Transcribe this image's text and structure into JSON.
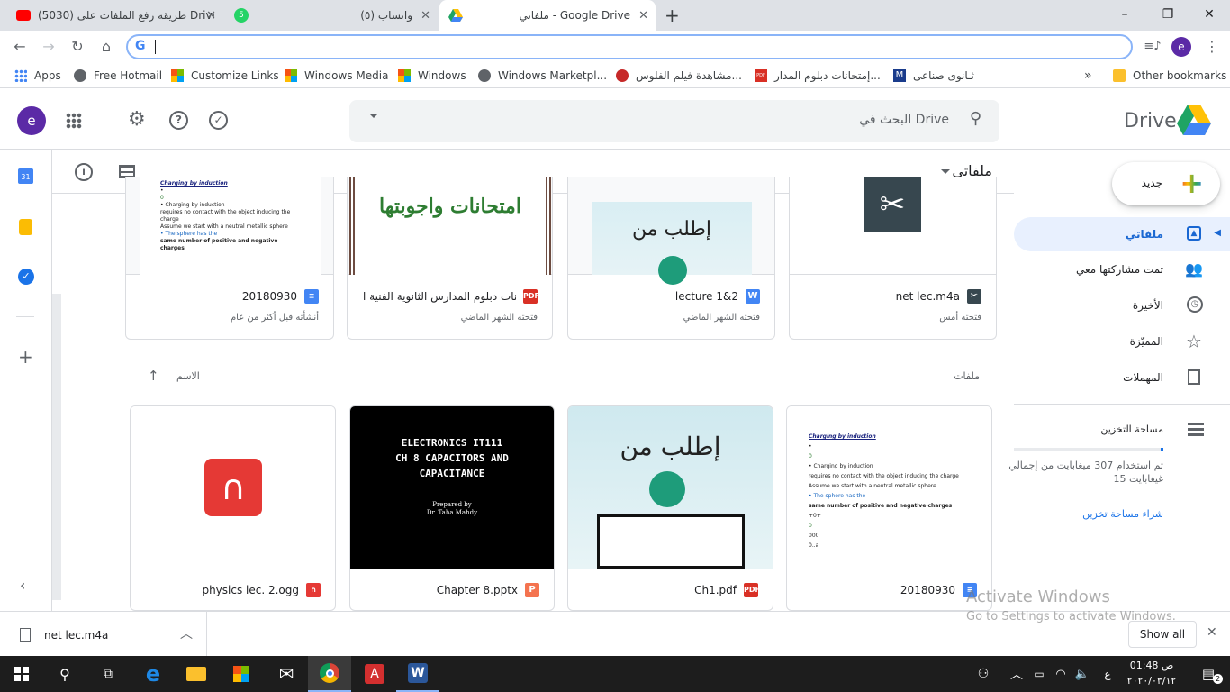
{
  "browser": {
    "tabs": [
      {
        "title": "(5030) طريقة رفع الملفات على Drive",
        "favicon_color": "#ff0000"
      },
      {
        "title": "(٥) واتساب",
        "favicon_color": "#25d366",
        "badge": "5"
      },
      {
        "title": "ملفاتي - Google Drive",
        "favicon_color": "#1fa463",
        "active": true
      }
    ],
    "new_tab": "+",
    "omnibox_value": "",
    "profile_initial": "e",
    "bookmarks": [
      {
        "label": "Apps"
      },
      {
        "label": "Free Hotmail"
      },
      {
        "label": "Customize Links"
      },
      {
        "label": "Windows Media"
      },
      {
        "label": "Windows"
      },
      {
        "label": "Windows Marketpl..."
      },
      {
        "label": "مشاهدة فيلم الفلوس..."
      },
      {
        "label": "إمتحانات دبلوم المدار..."
      },
      {
        "label": "ثـانوى صناعى"
      }
    ],
    "overflow": "»",
    "other_bookmarks": "Other bookmarks"
  },
  "drive": {
    "brand": "Drive",
    "search_placeholder": "البحث في Drive",
    "avatar_initial": "e",
    "breadcrumb": "ملفاتي",
    "new_button": "جديد",
    "nav": [
      {
        "label": "ملفاتي",
        "active": true
      },
      {
        "label": "تمت مشاركتها معي"
      },
      {
        "label": "الأخيرة"
      },
      {
        "label": "المميّزة"
      },
      {
        "label": "المهملات"
      }
    ],
    "storage": {
      "label": "مساحة التخزين",
      "usage_line1": "تم استخدام 307 ميغابايت من إجمالي",
      "usage_line2": "15 غيغابايت",
      "used_fraction": 0.02,
      "buy": "شراء مساحة تخزين"
    },
    "quick_access": [
      {
        "name": "net lec.m4a",
        "sub": "فتحته أمس",
        "type": "audio"
      },
      {
        "name": "lecture 1&2",
        "sub": "فتحته الشهر الماضي",
        "type": "word",
        "thumb_text": "إطلب من"
      },
      {
        "name": "إمتحانات دبلوم المدارس الثانوية الفنية ا...",
        "sub": "فتحته الشهر الماضي",
        "type": "pdf",
        "thumb_text": "امتحانات واجوبتها"
      },
      {
        "name": "20180930",
        "sub": "أنشأته قبل أكثر من عام",
        "type": "doc"
      }
    ],
    "files_header": "ملفات",
    "sort_label": "الاسم",
    "files": [
      {
        "name": "20180930",
        "type": "doc"
      },
      {
        "name": "Ch1.pdf",
        "type": "pdf",
        "thumb_text": "إطلب من"
      },
      {
        "name": "Chapter 8.pptx",
        "type": "ppt",
        "thumb_lines": [
          "ELECTRONICS IT111",
          "CH 8 CAPACITORS AND",
          "CAPACITANCE"
        ],
        "thumb_sub": [
          "Prepared by",
          "Dr. Taha Mahdy"
        ]
      },
      {
        "name": "physics lec. 2.ogg",
        "type": "audio"
      }
    ],
    "doc_preview": [
      "Charging by induction",
      "•",
      "0",
      "• Charging by induction",
      "requires no contact with the object inducing the charge",
      "Assume we start with a neutral metallic sphere",
      "• The sphere has the",
      "same number of positive and negative charges",
      "+0+",
      "0",
      "000",
      "0..a"
    ],
    "watermark_title": "Activate Windows",
    "watermark_sub": "Go to Settings to activate Windows."
  },
  "downloads": {
    "file": "net lec.m4a",
    "show_all": "Show all"
  },
  "taskbar": {
    "time": "01:48 ص",
    "date": "٢٠٢٠/٠٣/١٢",
    "lang": "ع",
    "notification_count": "2"
  }
}
